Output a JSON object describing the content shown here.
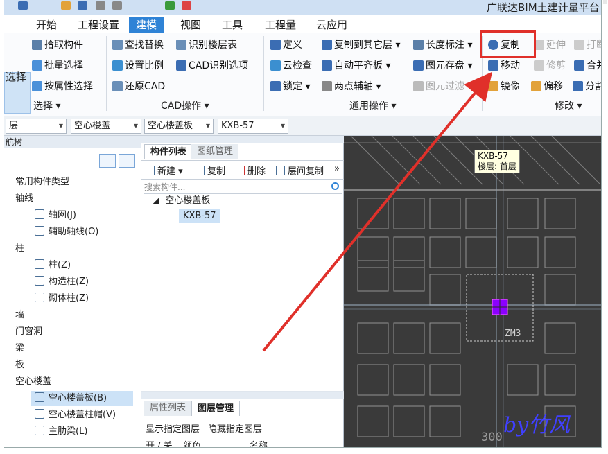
{
  "app": {
    "title": "广联达BIM土建计量平台"
  },
  "ribbon_tabs": [
    "开始",
    "工程设置",
    "建模",
    "视图",
    "工具",
    "工程量",
    "云应用"
  ],
  "ribbon": {
    "select_group": {
      "big_button": "选择",
      "items": [
        "拾取构件",
        "批量选择",
        "按属性选择"
      ],
      "label": "选择"
    },
    "cad_group": {
      "items": [
        "查找替换",
        "识别楼层表",
        "设置比例",
        "CAD识别选项",
        "还原CAD"
      ],
      "label": "CAD操作"
    },
    "common_group": {
      "items": [
        "定义",
        "复制到其它层",
        "长度标注",
        "云检查",
        "自动平齐板",
        "图元存盘",
        "锁定",
        "两点辅轴",
        "图元过滤"
      ],
      "label": "通用操作"
    },
    "modify_group": {
      "items": [
        "复制",
        "延伸",
        "打断",
        "移动",
        "修剪",
        "合并",
        "镜像",
        "偏移",
        "分割"
      ],
      "label": "修改"
    }
  },
  "selectors": {
    "floor": "层",
    "category": "空心楼盖",
    "subtype": "空心楼盖板",
    "component": "KXB-57"
  },
  "nav": {
    "title": "航树",
    "items": [
      "常用构件类型",
      "轴线",
      "轴网(J)",
      "辅助轴线(O)",
      "柱",
      "柱(Z)",
      "构造柱(Z)",
      "砌体柱(Z)",
      "墙",
      "门窗洞",
      "梁",
      "板",
      "空心楼盖",
      "空心楼盖板(B)",
      "空心楼盖柱帽(V)",
      "主肋梁(L)"
    ]
  },
  "complist": {
    "tabs": [
      "构件列表",
      "图纸管理"
    ],
    "toolbar": [
      "新建",
      "复制",
      "删除",
      "层间复制"
    ],
    "search_placeholder": "搜索构件...",
    "tree_root": "空心楼盖板",
    "tree_child": "KXB-57"
  },
  "proppanel": {
    "tabs": [
      "属性列表",
      "图层管理"
    ],
    "actions": [
      "显示指定图层",
      "隐藏指定图层"
    ],
    "columns": [
      "开 / 关",
      "颜色",
      "名称"
    ]
  },
  "canvas": {
    "tooltip_line1": "KXB-57",
    "tooltip_line2": "楼层: 首层",
    "zm_label": "ZM3",
    "dim_label": "300",
    "watermark": "by竹风"
  },
  "colors": {
    "accent": "#2f83d6",
    "highlight_box": "#e0302a",
    "arrow": "#e0302a",
    "selected_square": "#8b00ff"
  }
}
